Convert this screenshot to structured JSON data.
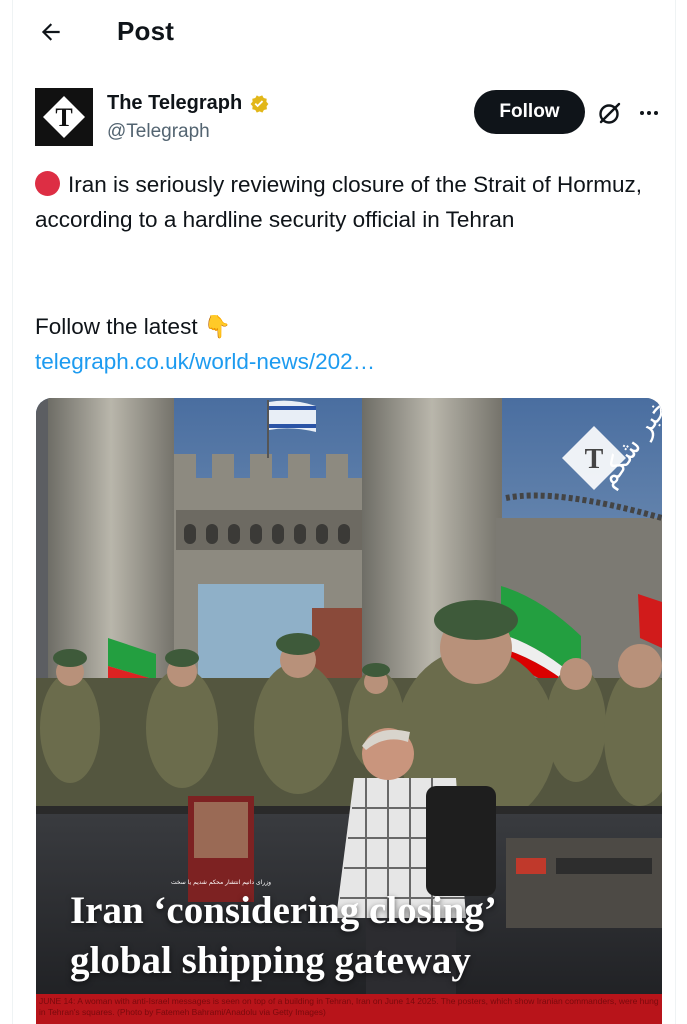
{
  "header": {
    "title": "Post",
    "back_icon": "arrow-left-icon"
  },
  "author": {
    "name": "The Telegraph",
    "handle": "@Telegraph",
    "verified_icon": "verified-badge-icon",
    "badge_color": "#e2b719",
    "avatar_icon": "telegraph-logo-icon"
  },
  "actions": {
    "follow_label": "Follow",
    "grok_icon": "grok-icon",
    "more_icon": "more-icon"
  },
  "post": {
    "text": "Iran is seriously reviewing closure of the Strait of Hormuz, according to a hardline security official in Tehran",
    "follow_text": "Follow the latest",
    "pointing_emoji": "👇",
    "link": "telegraph.co.uk/world-news/202…",
    "link_color": "#1d9bf0"
  },
  "media": {
    "headline_line1": "Iran ‘considering closing’",
    "headline_line2": "global shipping gateway",
    "poster_text": "وزرای دانیم انتشار\nمحکم شدیم یا سخت",
    "watermark_text": "خبر شکم",
    "caption": "JUNE 14: A woman with anti-Israel messages is seen on top of a building in Tehran, Iran on June 14 2025. The posters, which show Iranian commanders, were hung in Tehran's squares. (Photo by Fatemeh Bahrami/Anadolu via Getty Images)"
  }
}
